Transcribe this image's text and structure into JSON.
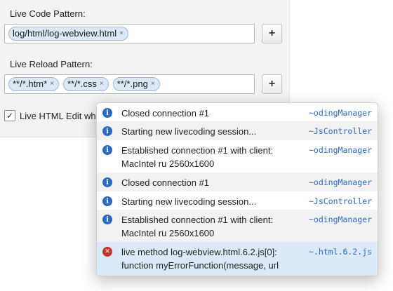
{
  "settings": {
    "live_code_label": "Live Code Pattern:",
    "live_code_tags": [
      "log/html/log-webview.html"
    ],
    "live_reload_label": "Live Reload Pattern:",
    "live_reload_tags": [
      "**/*.htm*",
      "**/*.css",
      "**/*.png"
    ],
    "add_button": "+",
    "remove_tag": "×",
    "live_html_label": "Live HTML Edit wh",
    "live_html_checked": true
  },
  "log": {
    "entries": [
      {
        "type": "info",
        "icon": "info-icon",
        "message": "Closed connection #1",
        "source": "~odingManager"
      },
      {
        "type": "info",
        "icon": "info-icon",
        "message": "Starting new livecoding session...",
        "source": "~JsController"
      },
      {
        "type": "info",
        "icon": "info-icon",
        "message": "Established connection #1 with client: MacIntel ru 2560x1600",
        "source": "~odingManager"
      },
      {
        "type": "info",
        "icon": "info-icon",
        "message": "Closed connection #1",
        "source": "~odingManager"
      },
      {
        "type": "info",
        "icon": "info-icon",
        "message": "Starting new livecoding session...",
        "source": "~JsController"
      },
      {
        "type": "info",
        "icon": "info-icon",
        "message": "Established connection #1 with client: MacIntel ru 2560x1600",
        "source": "~odingManager"
      },
      {
        "type": "error",
        "icon": "error-icon",
        "message": "live method log-webview.html.6.2.js[0]: function myErrorFunction(message, url",
        "source": "~.html.6.2.js"
      }
    ]
  },
  "colors": {
    "info": "#2a6bc6",
    "error": "#c0392b",
    "link": "#2a6bc6"
  }
}
